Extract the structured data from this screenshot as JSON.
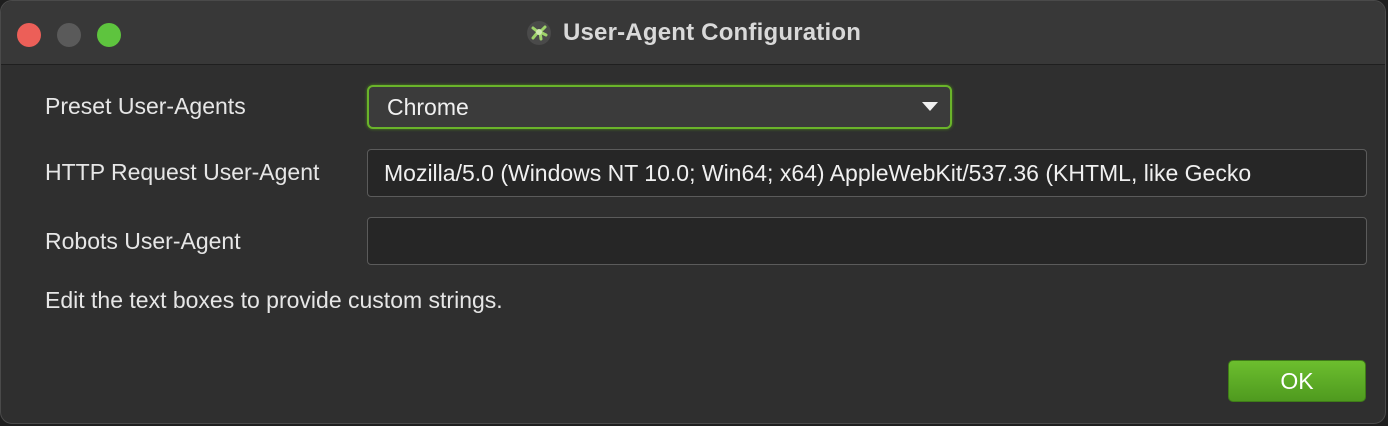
{
  "window": {
    "title": "User-Agent Configuration",
    "app_icon": "spider-frog-icon"
  },
  "form": {
    "preset_label": "Preset User-Agents",
    "preset_value": "Chrome",
    "http_label": "HTTP Request User-Agent",
    "http_value": "Mozilla/5.0 (Windows NT 10.0; Win64; x64) AppleWebKit/537.36 (KHTML, like Gecko",
    "robots_label": "Robots User-Agent",
    "robots_value": "",
    "hint": "Edit the text boxes to provide custom strings."
  },
  "buttons": {
    "ok_label": "OK"
  },
  "colors": {
    "accent_green": "#6ab42a",
    "close": "#ec5f58",
    "zoom": "#5ec43e"
  }
}
